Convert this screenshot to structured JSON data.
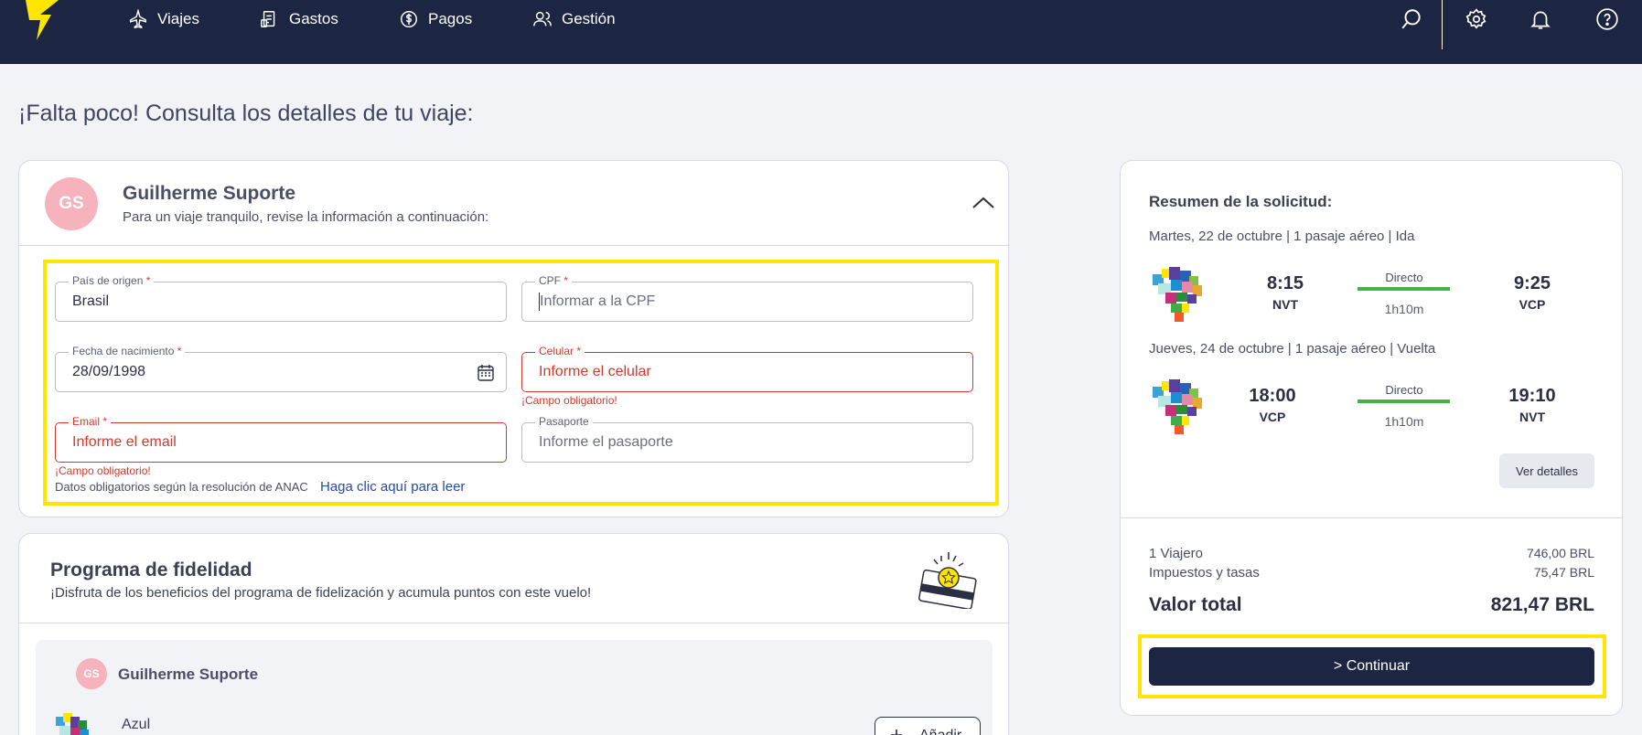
{
  "nav": {
    "items": [
      {
        "label": "Viajes",
        "icon": "plane-icon"
      },
      {
        "label": "Gastos",
        "icon": "receipt-icon"
      },
      {
        "label": "Pagos",
        "icon": "dollar-icon"
      },
      {
        "label": "Gestión",
        "icon": "users-icon"
      }
    ]
  },
  "page": {
    "title": "¡Falta poco! Consulta los detalles de tu viaje:"
  },
  "traveler": {
    "initials": "GS",
    "name": "Guilherme Suporte",
    "subtitle": "Para un viaje tranquilo, revise la información a continuación:",
    "fields": {
      "country": {
        "label": "País de origen",
        "value": "Brasil"
      },
      "cpf": {
        "label": "CPF",
        "placeholder": "Informar a la CPF"
      },
      "birth": {
        "label": "Fecha de nacimiento",
        "value": "28/09/1998"
      },
      "phone": {
        "label": "Celular",
        "placeholder": "Informe el celular",
        "error": "¡Campo obligatorio!"
      },
      "email": {
        "label": "Email",
        "placeholder": "Informe el email",
        "error": "¡Campo obligatorio!"
      },
      "passport": {
        "label": "Pasaporte",
        "placeholder": "Informe el pasaporte"
      }
    },
    "required_mark": "*",
    "anac_text": "Datos obligatorios según la resolución de ANAC",
    "anac_link": "Haga clic aquí para leer"
  },
  "loyalty": {
    "title": "Programa de fidelidad",
    "subtitle": "¡Disfruta de los beneficios del programa de fidelización y acumula puntos con este vuelo!",
    "traveler_initials": "GS",
    "traveler_name": "Guilherme Suporte",
    "airline": "Azul",
    "add_label": "Añadir"
  },
  "summary": {
    "title": "Resumen de la solicitud:",
    "legs": [
      {
        "header": "Martes, 22 de octubre | 1 pasaje aéreo | Ida",
        "dep_time": "8:15",
        "dep_code": "NVT",
        "arr_time": "9:25",
        "arr_code": "VCP",
        "type": "Directo",
        "duration": "1h10m"
      },
      {
        "header": "Jueves, 24 de octubre | 1 pasaje aéreo | Vuelta",
        "dep_time": "18:00",
        "dep_code": "VCP",
        "arr_time": "19:10",
        "arr_code": "NVT",
        "type": "Directo",
        "duration": "1h10m"
      }
    ],
    "details_label": "Ver detalles",
    "travelers_label": "1 Viajero",
    "travelers_value": "746,00 BRL",
    "taxes_label": "Impuestos y tasas",
    "taxes_value": "75,47 BRL",
    "total_label": "Valor total",
    "total_value": "821,47 BRL",
    "continue_label": "> Continuar"
  },
  "colors": {
    "header": "#1c2541",
    "accent_yellow": "#ffe600",
    "error": "#d33a2c",
    "route_green": "#46b04a"
  }
}
